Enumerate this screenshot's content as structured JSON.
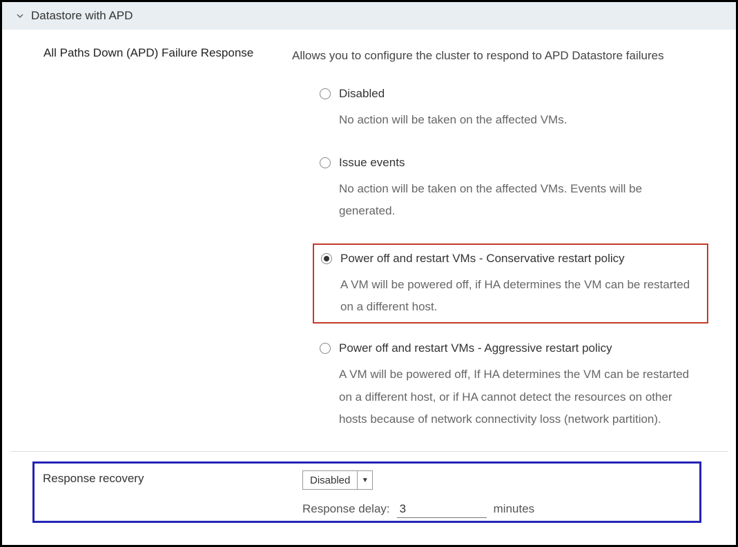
{
  "section": {
    "title": "Datastore with APD"
  },
  "apd": {
    "leftLabel": "All Paths Down (APD) Failure Response",
    "intro": "Allows you to configure the cluster to respond to APD Datastore failures",
    "options": [
      {
        "label": "Disabled",
        "desc": "No action will be taken on the affected VMs."
      },
      {
        "label": "Issue events",
        "desc": "No action will be taken on the affected VMs. Events will be generated."
      },
      {
        "label": "Power off and restart VMs - Conservative restart policy",
        "desc": "A VM will be powered off, if HA determines the VM can be restarted on a different host."
      },
      {
        "label": "Power off and restart VMs - Aggressive restart policy",
        "desc": "A VM will be powered off, If HA determines the VM can be restarted on a different host, or if HA cannot detect the resources on other hosts because of network connectivity loss (network partition)."
      }
    ]
  },
  "recovery": {
    "label": "Response recovery",
    "selected": "Disabled",
    "delayLabel": "Response delay:",
    "delayValue": "3",
    "delayUnit": "minutes"
  }
}
